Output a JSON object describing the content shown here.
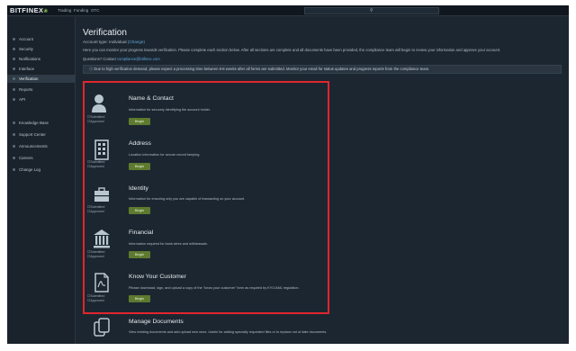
{
  "topbar": {
    "logo": "BITFINEX",
    "nav": [
      "Trading",
      "Funding",
      "OTC"
    ]
  },
  "sidebar": {
    "items": [
      {
        "label": "Account"
      },
      {
        "label": "Security"
      },
      {
        "label": "Notifications"
      },
      {
        "label": "Interface"
      },
      {
        "label": "Verification",
        "active": true
      },
      {
        "label": "Reports"
      },
      {
        "label": "API"
      },
      {
        "label": "Knowledge Base"
      },
      {
        "label": "Support Center"
      },
      {
        "label": "Announcements"
      },
      {
        "label": "Careers"
      },
      {
        "label": "Change Log"
      }
    ]
  },
  "page": {
    "title": "Verification",
    "account_type_label": "Account type: Individual",
    "change_link": "(Change)",
    "description": "Here you can monitor your progress towards verification. Please complete each section below. After all sections are complete and all documents have been provided, the compliance team will begin to review your information and approve your account.",
    "questions_label": "Questions? Contact",
    "questions_email": "compliance@bitfinex.com",
    "notice": "Due to high verification demand, please expect a processing time between 6-8 weeks after all forms are submitted. Monitor your email for status updates and progress reports from the compliance team."
  },
  "sections": [
    {
      "icon": "person-icon",
      "title": "Name & Contact",
      "desc": "Information for securely identifying the account holder.",
      "button": "Begin",
      "status_submitted": "Submitted",
      "status_approved": "Approved"
    },
    {
      "icon": "building-icon",
      "title": "Address",
      "desc": "Location information for secure record keeping.",
      "button": "Begin",
      "status_submitted": "Submitted",
      "status_approved": "Approved"
    },
    {
      "icon": "briefcase-icon",
      "title": "Identity",
      "desc": "Information for ensuring only you are capable of transacting on your account.",
      "button": "Begin",
      "status_submitted": "Submitted",
      "status_approved": "Approved"
    },
    {
      "icon": "bank-icon",
      "title": "Financial",
      "desc": "Information required for bank wires and withdrawals.",
      "button": "Begin",
      "status_submitted": "Submitted",
      "status_approved": "Approved"
    },
    {
      "icon": "pdf-document-icon",
      "title": "Know Your Customer",
      "desc": "Please download, sign, and upload a copy of the \"know your customer\" form as required by KYC/AML regulation.",
      "button": "Begin",
      "status_submitted": "Submitted",
      "status_approved": "Approved"
    },
    {
      "icon": "documents-icon",
      "title": "Manage Documents",
      "desc": "View existing documents and add upload new ones. Useful for adding specially requested files or to replace out of date documents."
    }
  ],
  "colors": {
    "background": "#1c2630",
    "sidebar": "#1a232c",
    "highlight_border": "#e0262e",
    "button": "#5d7a2f",
    "link": "#5fa8e0"
  }
}
